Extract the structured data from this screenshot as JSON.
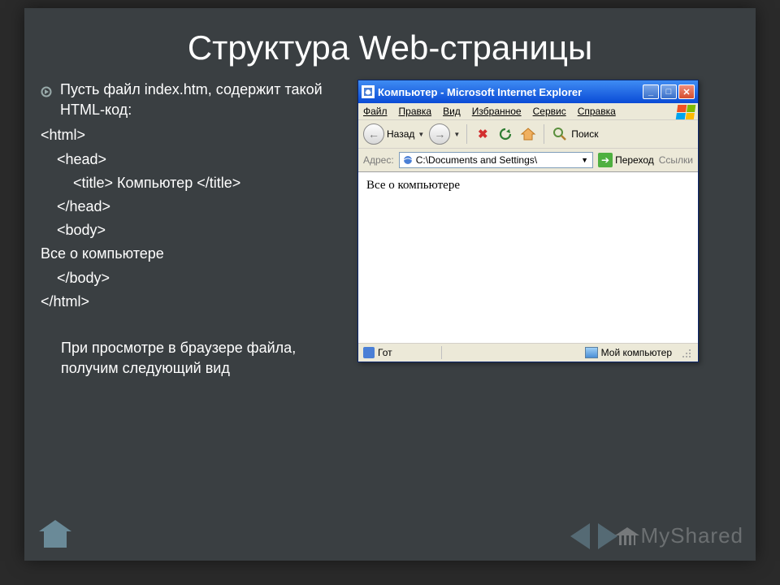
{
  "slide": {
    "title": "Структура Web-страницы",
    "bullet": "Пусть  файл index.htm, содержит такой HTML-код:",
    "code": {
      "l1": "<html>",
      "l2": "<head>",
      "l3": "<title> Компьютер </title>",
      "l4": "</head>",
      "l5": "<body>",
      "l6": "Все о компьютере",
      "l7": "</body>",
      "l8": "</html>"
    },
    "note": "При просмотре в браузере файла, получим следующий вид"
  },
  "browser": {
    "title": "Компьютер - Microsoft Internet Explorer",
    "menu": {
      "file": "Файл",
      "edit": "Правка",
      "view": "Вид",
      "favorites": "Избранное",
      "tools": "Сервис",
      "help": "Справка"
    },
    "toolbar": {
      "back": "Назад",
      "search": "Поиск"
    },
    "address": {
      "label": "Адрес:",
      "value": "C:\\Documents and Settings\\",
      "go": "Переход",
      "links": "Ссылки"
    },
    "page_body": "Все о компьютере",
    "status": {
      "left": "Гот",
      "zone": "Мой компьютер"
    }
  },
  "watermark": "MyShared"
}
